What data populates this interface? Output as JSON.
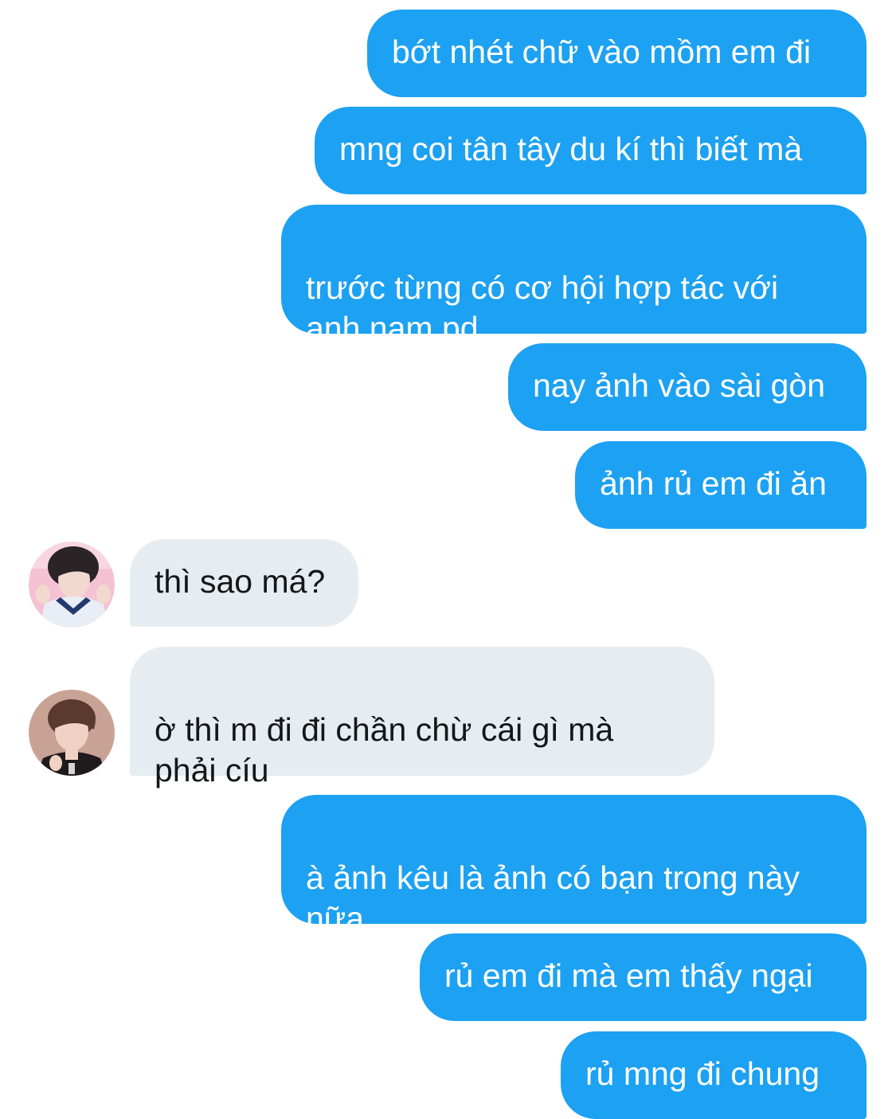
{
  "colors": {
    "outgoing_bubble": "#1da1f2",
    "outgoing_text": "#ffffff",
    "incoming_bubble": "#e6ecf0",
    "incoming_text": "#14171a"
  },
  "messages": [
    {
      "direction": "outgoing",
      "text": "bớt nhét chữ vào mồm em đi"
    },
    {
      "direction": "outgoing",
      "text": "mng coi tân tây du kí thì biết mà"
    },
    {
      "direction": "outgoing",
      "text": "trước từng có cơ hội hợp tác với\nanh nam pd"
    },
    {
      "direction": "outgoing",
      "text": "nay ảnh vào sài gòn"
    },
    {
      "direction": "outgoing",
      "text": "ảnh rủ em đi ăn"
    },
    {
      "direction": "incoming",
      "avatar": "user-avatar-1",
      "text": "thì sao má?"
    },
    {
      "direction": "incoming",
      "avatar": "user-avatar-2",
      "text": "ờ thì m đi đi chần chừ cái gì mà\nphải cíu"
    },
    {
      "direction": "outgoing",
      "text": "à ảnh kêu là ảnh có bạn trong này\nnữa"
    },
    {
      "direction": "outgoing",
      "text": "rủ em đi mà em thấy ngại"
    },
    {
      "direction": "outgoing",
      "text": "rủ mng đi chung"
    }
  ]
}
